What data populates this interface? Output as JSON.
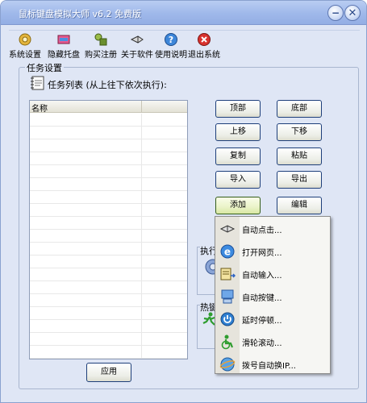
{
  "window": {
    "title": "鼠标键盘模拟大师 v6.2 免费版"
  },
  "titlebar": {
    "minimize_glyph": "−",
    "close_glyph": "✕"
  },
  "menubar": {
    "items": [
      {
        "label": "系统设置",
        "icon": "gear-icon"
      },
      {
        "label": "隐藏托盘",
        "icon": "hide-tray-icon"
      },
      {
        "label": "购买注册",
        "icon": "register-icon"
      },
      {
        "label": "关于软件",
        "icon": "mouse-pointer-icon"
      },
      {
        "label": "使用说明",
        "icon": "help-icon"
      },
      {
        "label": "退出系统",
        "icon": "exit-icon"
      }
    ]
  },
  "task_group": {
    "title": "任务设置",
    "list_label": "任务列表 (从上往下依次执行):",
    "columns": [
      "名称",
      ""
    ],
    "rows": []
  },
  "buttons": {
    "top": "顶部",
    "bottom": "底部",
    "up": "上移",
    "down": "下移",
    "copy": "复制",
    "paste": "粘贴",
    "import": "导入",
    "export": "导出",
    "add": "添加",
    "edit": "编辑",
    "apply": "应用"
  },
  "fragments": {
    "execute": "执行",
    "hotkey": "热键"
  },
  "add_menu": {
    "items": [
      {
        "label": "自动点击...",
        "icon": "mouse-icon"
      },
      {
        "label": "打开网页...",
        "icon": "browser-icon"
      },
      {
        "label": "自动输入...",
        "icon": "keyboard-input-icon"
      },
      {
        "label": "自动按键...",
        "icon": "key-press-icon"
      },
      {
        "label": "延时停顿...",
        "icon": "power-icon"
      },
      {
        "label": "滑轮滚动...",
        "icon": "wheel-scroll-icon"
      },
      {
        "label": "拨号自动换IP...",
        "icon": "dialup-icon"
      }
    ]
  }
}
